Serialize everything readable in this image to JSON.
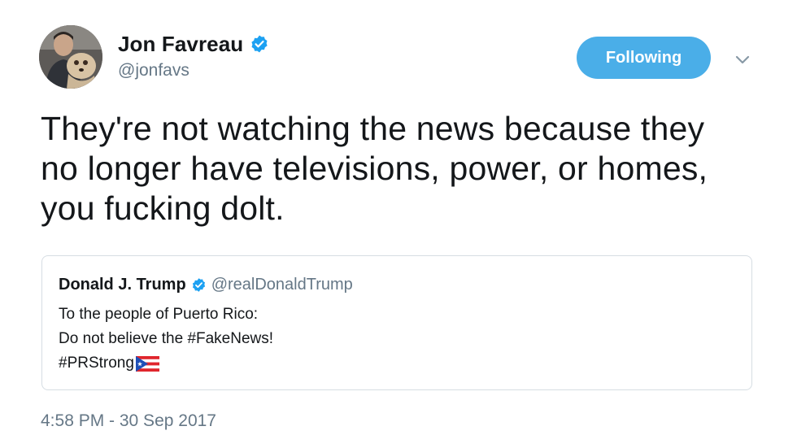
{
  "author": {
    "display_name": "Jon Favreau",
    "handle": "@jonfavs",
    "verified": true,
    "avatar_icon": "avatar-photo"
  },
  "follow_button": {
    "label": "Following",
    "color": "#4aaee8"
  },
  "menu_icon": "chevron-down-icon",
  "tweet": {
    "lines": [
      "They're not watching the news because they",
      "no longer have televisions, power, or homes,",
      "you fucking dolt."
    ]
  },
  "quoted_tweet": {
    "display_name": "Donald J. Trump",
    "handle": "@realDonaldTrump",
    "verified": true,
    "lines": [
      "To the people of Puerto Rico:",
      "Do not believe the #FakeNews!",
      "#PRStrong"
    ],
    "flag_icon": "puerto-rico-flag-icon"
  },
  "timestamp": "4:58 PM - 30 Sep 2017",
  "colors": {
    "verified_blue": "#1da1f2",
    "text_primary": "#14171a",
    "text_secondary": "#657786",
    "border": "#d6dde3"
  }
}
